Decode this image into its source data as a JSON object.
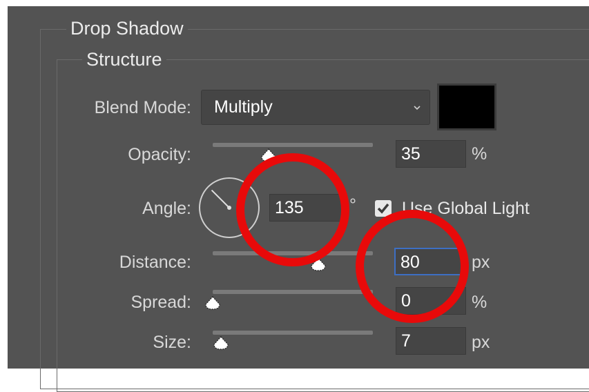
{
  "drop_shadow": {
    "title": "Drop Shadow",
    "structure": {
      "title": "Structure",
      "blend_mode": {
        "label": "Blend Mode:",
        "value": "Multiply",
        "color": "#000000"
      },
      "opacity": {
        "label": "Opacity:",
        "value": "35",
        "unit": "%",
        "slider_fraction": 0.35
      },
      "angle": {
        "label": "Angle:",
        "value": "135",
        "unit": "°",
        "degrees": 135,
        "use_global_light": {
          "checked": true,
          "label": "Use Global Light"
        }
      },
      "distance": {
        "label": "Distance:",
        "value": "80",
        "unit": "px",
        "slider_fraction": 0.66
      },
      "spread": {
        "label": "Spread:",
        "value": "0",
        "unit": "%",
        "slider_fraction": 0
      },
      "size": {
        "label": "Size:",
        "value": "7",
        "unit": "px",
        "slider_fraction": 0.05
      }
    }
  },
  "annotations": {
    "color": "#e80a0a"
  }
}
